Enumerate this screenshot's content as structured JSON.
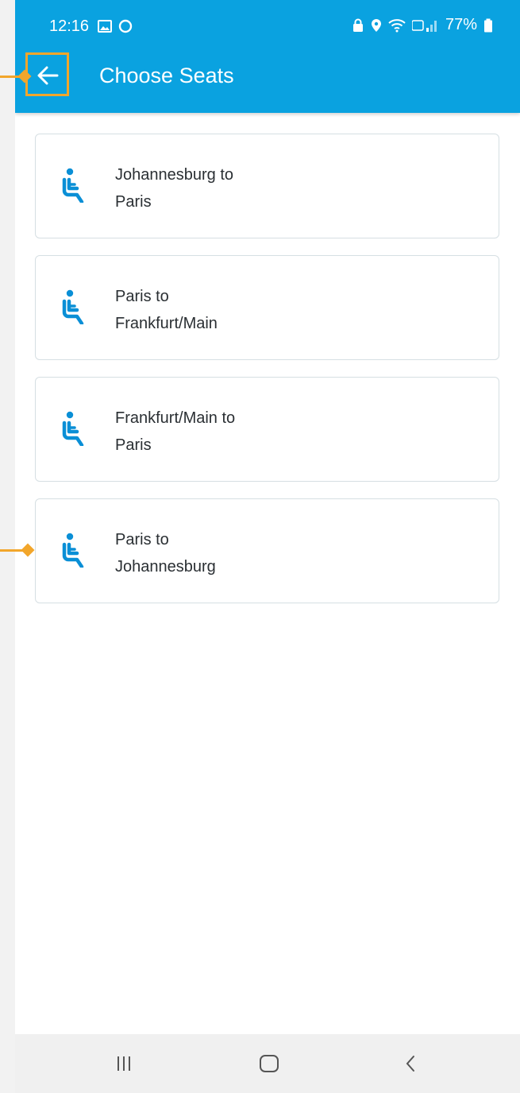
{
  "status_bar": {
    "time": "12:16",
    "battery_percent": "77%"
  },
  "header": {
    "title": "Choose Seats",
    "back_icon": "arrow-left-icon",
    "color": "#0aa2e0"
  },
  "segments": [
    {
      "label": "Johannesburg to\nParis",
      "icon": "seat-icon"
    },
    {
      "label": "Paris to\nFrankfurt/Main",
      "icon": "seat-icon"
    },
    {
      "label": "Frankfurt/Main to\nParis",
      "icon": "seat-icon"
    },
    {
      "label": "Paris to\nJohannesburg",
      "icon": "seat-icon"
    }
  ],
  "nav_bar": {
    "recents_icon": "recents-icon",
    "home_icon": "home-icon",
    "back_icon": "nav-back-icon"
  },
  "annotation_color": "#f2a62b"
}
